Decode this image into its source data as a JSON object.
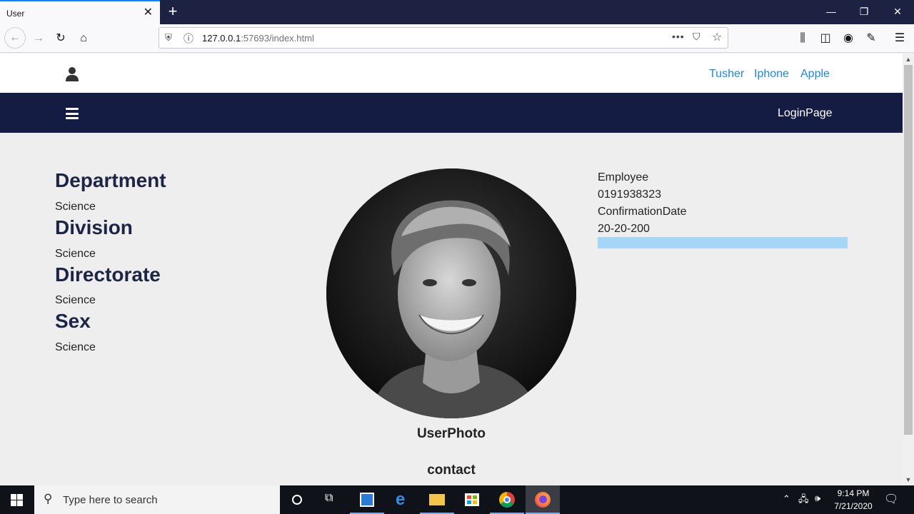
{
  "browser": {
    "tab_title": "User",
    "url_host": "127.0.0.1",
    "url_rest": ":57693/index.html"
  },
  "header": {
    "links": [
      "Tusher",
      "Iphone",
      "Apple"
    ],
    "login_label": "LoginPage"
  },
  "profile": {
    "fields": [
      {
        "label": "Department",
        "value": "Science"
      },
      {
        "label": "Division",
        "value": "Science"
      },
      {
        "label": "Directorate",
        "value": "Science"
      },
      {
        "label": "Sex",
        "value": "Science"
      }
    ],
    "photo_caption": "UserPhoto",
    "contact_caption": "contact",
    "right_info": [
      "Employee",
      "0191938323",
      "ConfirmationDate",
      "20-20-200"
    ]
  },
  "taskbar": {
    "search_placeholder": "Type here to search",
    "time": "9:14 PM",
    "date": "7/21/2020"
  },
  "colors": {
    "nav_bg": "#141c44",
    "link": "#1e88e5",
    "heading": "#1d2545",
    "info_bar": "#a5d6f5"
  }
}
